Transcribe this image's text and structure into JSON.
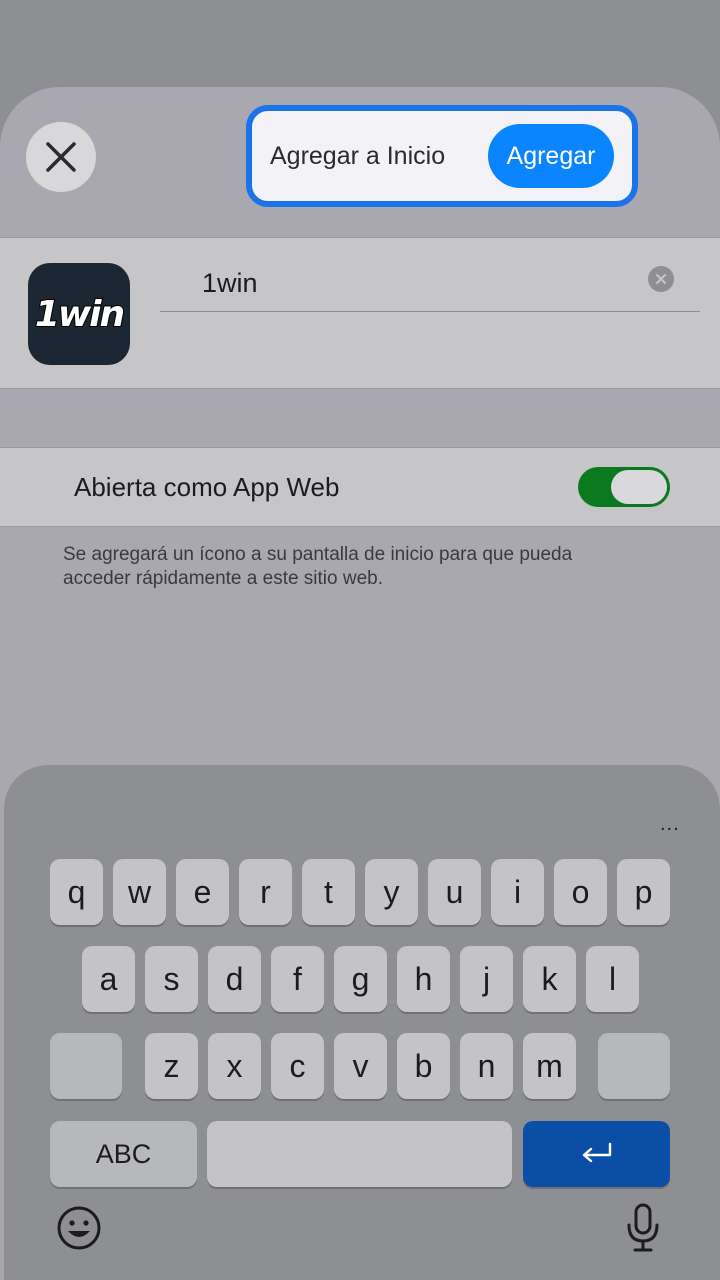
{
  "dialog": {
    "title": "Agregar a Inicio",
    "add_label": "Agregar"
  },
  "app": {
    "icon_text": "1win",
    "name_value": "1win"
  },
  "web_app": {
    "label": "Abierta como App Web",
    "enabled": true
  },
  "footnote": "Se agregará un ícono a su pantalla de inicio para que pueda acceder rápidamente a este sitio web.",
  "keyboard": {
    "more_label": "...",
    "row1": [
      "q",
      "w",
      "e",
      "r",
      "t",
      "y",
      "u",
      "i",
      "o",
      "p"
    ],
    "row2": [
      "a",
      "s",
      "d",
      "f",
      "g",
      "h",
      "j",
      "k",
      "l"
    ],
    "row3": [
      "z",
      "x",
      "c",
      "v",
      "b",
      "n",
      "m"
    ],
    "abc_label": "ABC"
  },
  "colors": {
    "accent": "#0a84ff",
    "highlight_border": "#1a73e8",
    "toggle_on": "#0b7a1f",
    "return_key": "#0a4fa5"
  }
}
